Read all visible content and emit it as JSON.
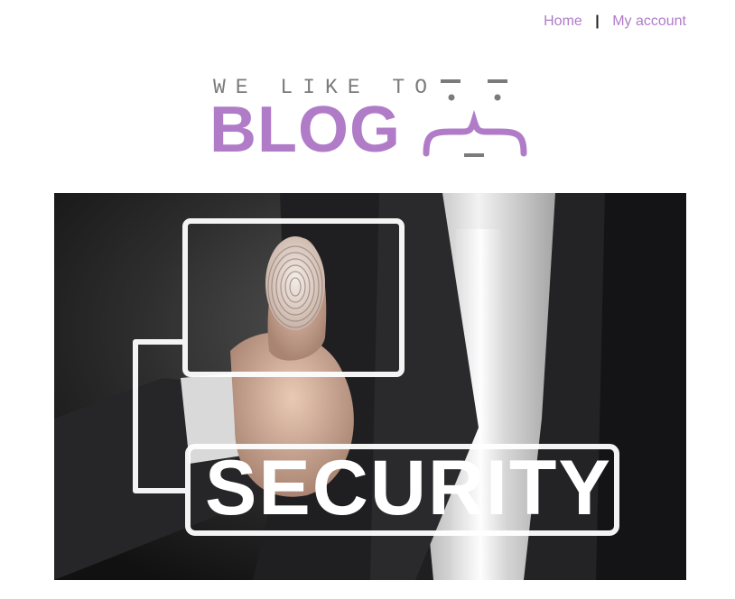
{
  "nav": {
    "home_label": "Home",
    "separator": "|",
    "account_label": "My account"
  },
  "logo": {
    "tagline": "WE LIKE TO",
    "word": "BLOG"
  },
  "hero": {
    "overlay_text": "SECURITY"
  },
  "colors": {
    "accent": "#b07cc8",
    "tagline_gray": "#7b7b7b",
    "nav_separator": "#222222"
  },
  "icons": {
    "logo_face": "curly-brace-face-icon",
    "fingerprint": "fingerprint-icon"
  }
}
